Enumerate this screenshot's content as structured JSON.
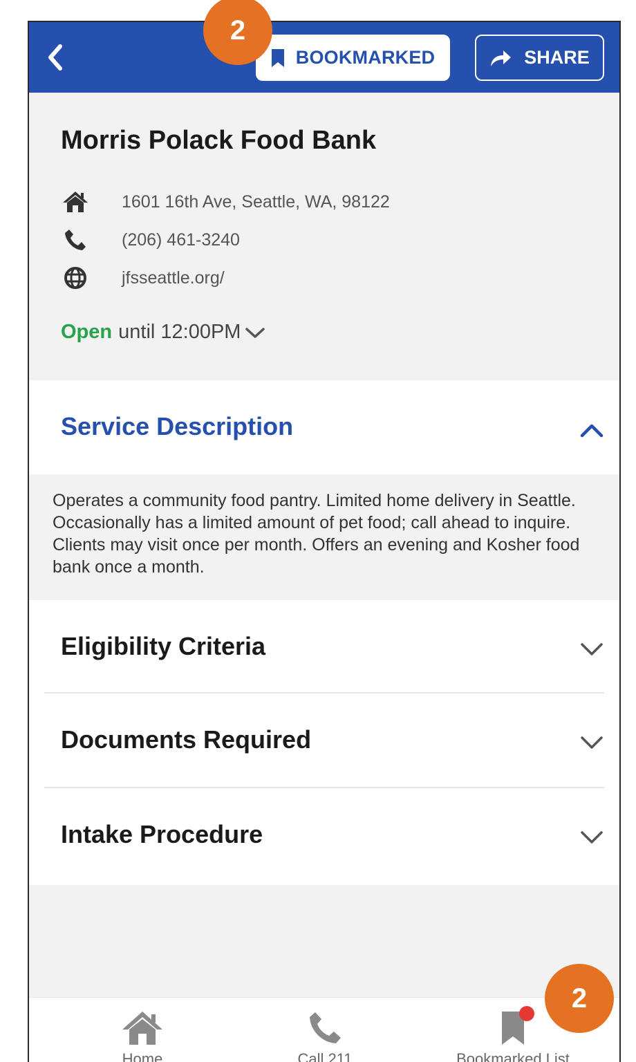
{
  "header": {
    "bookmark_label": "BOOKMARKED",
    "share_label": "SHARE"
  },
  "provider": {
    "name": "Morris Polack Food Bank",
    "address": "1601 16th Ave, Seattle, WA, 98122",
    "phone": "(206) 461-3240",
    "website": "jfsseattle.org/",
    "status": "Open",
    "hours": "until 12:00PM"
  },
  "sections": {
    "service_description": {
      "label": "Service Description",
      "text": "Operates a community food pantry. Limited home delivery in Seattle. Occasionally has a limited amount of pet food; call ahead to inquire. Clients may visit once per month. Offers an evening and Kosher food bank once a month."
    },
    "eligibility": {
      "label": "Eligibility Criteria"
    },
    "documents": {
      "label": "Documents Required"
    },
    "intake": {
      "label": "Intake Procedure"
    }
  },
  "bottom_nav": {
    "home": "Home",
    "call": "Call 211",
    "bookmarked": "Bookmarked List"
  },
  "callouts": {
    "top": "2",
    "bottom": "2"
  },
  "colors": {
    "primary": "#2550ad",
    "open": "#27a34a",
    "callout": "#e57122",
    "notification": "#e53935"
  }
}
